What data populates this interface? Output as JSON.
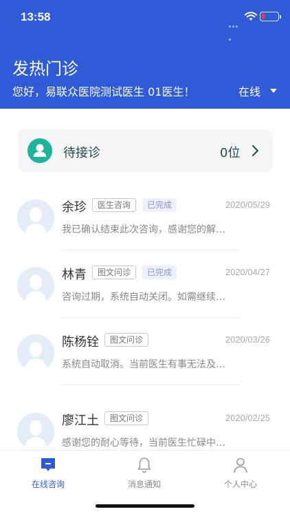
{
  "status_bar": {
    "time": "13:58"
  },
  "header": {
    "title": "发热门诊",
    "greeting": "您好，易联众医院测试医生 01医生！",
    "status": "在线"
  },
  "waiting": {
    "label": "待接诊",
    "count": "0位"
  },
  "consultations": [
    {
      "name": "余珍",
      "type": "医生咨询",
      "status": "已完成",
      "date": "2020/05/29",
      "preview": "我已确认结束此次咨询，感谢您的解…"
    },
    {
      "name": "林青",
      "type": "图文问诊",
      "status": "已完成",
      "date": "2020/04/27",
      "preview": "咨询过期，系统自动关闭。如需继续…"
    },
    {
      "name": "陈杨铨",
      "type": "图文问诊",
      "status": "",
      "date": "2020/03/26",
      "preview": "系统自动取消。当前医生有事无法及…"
    },
    {
      "name": "廖江土",
      "type": "图文问诊",
      "status": "",
      "date": "2020/02/25",
      "preview": "感谢您的耐心等待，当前医生忙碌中…"
    }
  ],
  "tabbar": {
    "tabs": [
      {
        "label": "在线咨询",
        "active": true
      },
      {
        "label": "消息通知",
        "active": false
      },
      {
        "label": "个人中心",
        "active": false
      }
    ]
  },
  "colors": {
    "brand": "#2f5bd8",
    "waiting_icon": "#1cb59b",
    "battery_low": "#ff3b30"
  }
}
